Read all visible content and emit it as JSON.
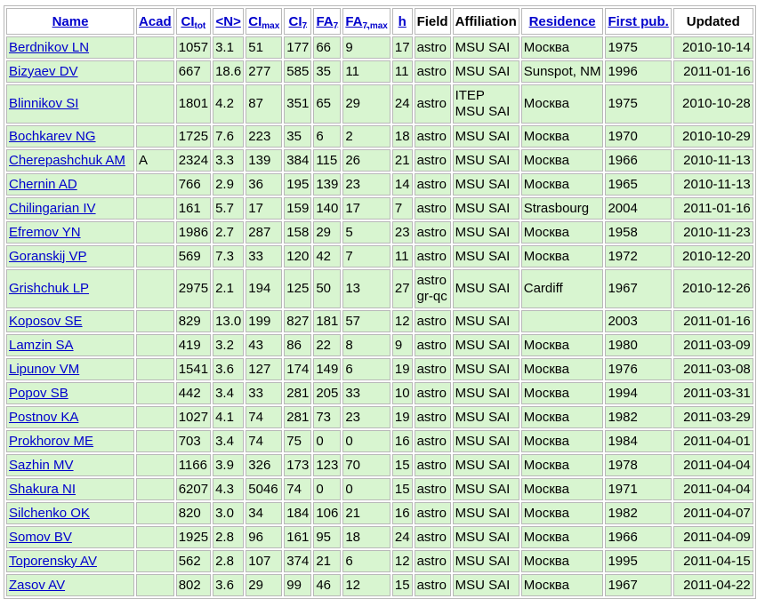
{
  "headers": {
    "name": "Name",
    "acad": "Acad",
    "ci_tot_main": "CI",
    "ci_tot_sub": "tot",
    "n": "<N>",
    "ci_max_main": "CI",
    "ci_max_sub": "max",
    "ci7_main": "CI",
    "ci7_sub": "7",
    "fa7_main": "FA",
    "fa7_sub": "7",
    "fa7max_main": "FA",
    "fa7max_sub": "7,max",
    "h": "h",
    "field": "Field",
    "affiliation": "Affiliation",
    "residence": "Residence",
    "first_pub": "First pub.",
    "updated": "Updated"
  },
  "rows": [
    {
      "name": "Berdnikov LN",
      "acad": "",
      "ci_tot": "1057",
      "n": "3.1",
      "ci_max": "51",
      "ci7": "177",
      "fa7": "66",
      "fa7max": "9",
      "h": "17",
      "field": [
        "astro"
      ],
      "affiliation": [
        "MSU SAI"
      ],
      "residence": "Москва",
      "first_pub": "1975",
      "updated": "2010-10-14"
    },
    {
      "name": "Bizyaev DV",
      "acad": "",
      "ci_tot": "667",
      "n": "18.6",
      "ci_max": "277",
      "ci7": "585",
      "fa7": "35",
      "fa7max": "11",
      "h": "11",
      "field": [
        "astro"
      ],
      "affiliation": [
        "MSU SAI"
      ],
      "residence": "Sunspot, NM",
      "first_pub": "1996",
      "updated": "2011-01-16"
    },
    {
      "name": "Blinnikov SI",
      "acad": "",
      "ci_tot": "1801",
      "n": "4.2",
      "ci_max": "87",
      "ci7": "351",
      "fa7": "65",
      "fa7max": "29",
      "h": "24",
      "field": [
        "astro"
      ],
      "affiliation": [
        "ITEP",
        "MSU SAI"
      ],
      "residence": "Москва",
      "first_pub": "1975",
      "updated": "2010-10-28"
    },
    {
      "name": "Bochkarev NG",
      "acad": "",
      "ci_tot": "1725",
      "n": "7.6",
      "ci_max": "223",
      "ci7": "35",
      "fa7": "6",
      "fa7max": "2",
      "h": "18",
      "field": [
        "astro"
      ],
      "affiliation": [
        "MSU SAI"
      ],
      "residence": "Москва",
      "first_pub": "1970",
      "updated": "2010-10-29"
    },
    {
      "name": "Cherepashchuk AM",
      "acad": "A",
      "ci_tot": "2324",
      "n": "3.3",
      "ci_max": "139",
      "ci7": "384",
      "fa7": "115",
      "fa7max": "26",
      "h": "21",
      "field": [
        "astro"
      ],
      "affiliation": [
        "MSU SAI"
      ],
      "residence": "Москва",
      "first_pub": "1966",
      "updated": "2010-11-13"
    },
    {
      "name": "Chernin AD",
      "acad": "",
      "ci_tot": "766",
      "n": "2.9",
      "ci_max": "36",
      "ci7": "195",
      "fa7": "139",
      "fa7max": "23",
      "h": "14",
      "field": [
        "astro"
      ],
      "affiliation": [
        "MSU SAI"
      ],
      "residence": "Москва",
      "first_pub": "1965",
      "updated": "2010-11-13"
    },
    {
      "name": "Chilingarian IV",
      "acad": "",
      "ci_tot": "161",
      "n": "5.7",
      "ci_max": "17",
      "ci7": "159",
      "fa7": "140",
      "fa7max": "17",
      "h": "7",
      "field": [
        "astro"
      ],
      "affiliation": [
        "MSU SAI"
      ],
      "residence": "Strasbourg",
      "first_pub": "2004",
      "updated": "2011-01-16"
    },
    {
      "name": "Efremov YN",
      "acad": "",
      "ci_tot": "1986",
      "n": "2.7",
      "ci_max": "287",
      "ci7": "158",
      "fa7": "29",
      "fa7max": "5",
      "h": "23",
      "field": [
        "astro"
      ],
      "affiliation": [
        "MSU SAI"
      ],
      "residence": "Москва",
      "first_pub": "1958",
      "updated": "2010-11-23"
    },
    {
      "name": "Goranskij VP",
      "acad": "",
      "ci_tot": "569",
      "n": "7.3",
      "ci_max": "33",
      "ci7": "120",
      "fa7": "42",
      "fa7max": "7",
      "h": "11",
      "field": [
        "astro"
      ],
      "affiliation": [
        "MSU SAI"
      ],
      "residence": "Москва",
      "first_pub": "1972",
      "updated": "2010-12-20"
    },
    {
      "name": "Grishchuk LP",
      "acad": "",
      "ci_tot": "2975",
      "n": "2.1",
      "ci_max": "194",
      "ci7": "125",
      "fa7": "50",
      "fa7max": "13",
      "h": "27",
      "field": [
        "astro",
        "gr-qc"
      ],
      "affiliation": [
        "MSU SAI"
      ],
      "residence": "Cardiff",
      "first_pub": "1967",
      "updated": "2010-12-26"
    },
    {
      "name": "Koposov SE",
      "acad": "",
      "ci_tot": "829",
      "n": "13.0",
      "ci_max": "199",
      "ci7": "827",
      "fa7": "181",
      "fa7max": "57",
      "h": "12",
      "field": [
        "astro"
      ],
      "affiliation": [
        "MSU SAI"
      ],
      "residence": "",
      "first_pub": "2003",
      "updated": "2011-01-16"
    },
    {
      "name": "Lamzin SA",
      "acad": "",
      "ci_tot": "419",
      "n": "3.2",
      "ci_max": "43",
      "ci7": "86",
      "fa7": "22",
      "fa7max": "8",
      "h": "9",
      "field": [
        "astro"
      ],
      "affiliation": [
        "MSU SAI"
      ],
      "residence": "Москва",
      "first_pub": "1980",
      "updated": "2011-03-09"
    },
    {
      "name": "Lipunov VM",
      "acad": "",
      "ci_tot": "1541",
      "n": "3.6",
      "ci_max": "127",
      "ci7": "174",
      "fa7": "149",
      "fa7max": "6",
      "h": "19",
      "field": [
        "astro"
      ],
      "affiliation": [
        "MSU SAI"
      ],
      "residence": "Москва",
      "first_pub": "1976",
      "updated": "2011-03-08"
    },
    {
      "name": "Popov SB",
      "acad": "",
      "ci_tot": "442",
      "n": "3.4",
      "ci_max": "33",
      "ci7": "281",
      "fa7": "205",
      "fa7max": "33",
      "h": "10",
      "field": [
        "astro"
      ],
      "affiliation": [
        "MSU SAI"
      ],
      "residence": "Москва",
      "first_pub": "1994",
      "updated": "2011-03-31"
    },
    {
      "name": "Postnov KA",
      "acad": "",
      "ci_tot": "1027",
      "n": "4.1",
      "ci_max": "74",
      "ci7": "281",
      "fa7": "73",
      "fa7max": "23",
      "h": "19",
      "field": [
        "astro"
      ],
      "affiliation": [
        "MSU SAI"
      ],
      "residence": "Москва",
      "first_pub": "1982",
      "updated": "2011-03-29"
    },
    {
      "name": "Prokhorov ME",
      "acad": "",
      "ci_tot": "703",
      "n": "3.4",
      "ci_max": "74",
      "ci7": "75",
      "fa7": "0",
      "fa7max": "0",
      "h": "16",
      "field": [
        "astro"
      ],
      "affiliation": [
        "MSU SAI"
      ],
      "residence": "Москва",
      "first_pub": "1984",
      "updated": "2011-04-01"
    },
    {
      "name": "Sazhin MV",
      "acad": "",
      "ci_tot": "1166",
      "n": "3.9",
      "ci_max": "326",
      "ci7": "173",
      "fa7": "123",
      "fa7max": "70",
      "h": "15",
      "field": [
        "astro"
      ],
      "affiliation": [
        "MSU SAI"
      ],
      "residence": "Москва",
      "first_pub": "1978",
      "updated": "2011-04-04"
    },
    {
      "name": "Shakura NI",
      "acad": "",
      "ci_tot": "6207",
      "n": "4.3",
      "ci_max": "5046",
      "ci7": "74",
      "fa7": "0",
      "fa7max": "0",
      "h": "15",
      "field": [
        "astro"
      ],
      "affiliation": [
        "MSU SAI"
      ],
      "residence": "Москва",
      "first_pub": "1971",
      "updated": "2011-04-04"
    },
    {
      "name": "Silchenko OK",
      "acad": "",
      "ci_tot": "820",
      "n": "3.0",
      "ci_max": "34",
      "ci7": "184",
      "fa7": "106",
      "fa7max": "21",
      "h": "16",
      "field": [
        "astro"
      ],
      "affiliation": [
        "MSU SAI"
      ],
      "residence": "Москва",
      "first_pub": "1982",
      "updated": "2011-04-07"
    },
    {
      "name": "Somov BV",
      "acad": "",
      "ci_tot": "1925",
      "n": "2.8",
      "ci_max": "96",
      "ci7": "161",
      "fa7": "95",
      "fa7max": "18",
      "h": "24",
      "field": [
        "astro"
      ],
      "affiliation": [
        "MSU SAI"
      ],
      "residence": "Москва",
      "first_pub": "1966",
      "updated": "2011-04-09"
    },
    {
      "name": "Toporensky AV",
      "acad": "",
      "ci_tot": "562",
      "n": "2.8",
      "ci_max": "107",
      "ci7": "374",
      "fa7": "21",
      "fa7max": "6",
      "h": "12",
      "field": [
        "astro"
      ],
      "affiliation": [
        "MSU SAI"
      ],
      "residence": "Москва",
      "first_pub": "1995",
      "updated": "2011-04-15"
    },
    {
      "name": "Zasov AV",
      "acad": "",
      "ci_tot": "802",
      "n": "3.6",
      "ci_max": "29",
      "ci7": "99",
      "fa7": "46",
      "fa7max": "12",
      "h": "15",
      "field": [
        "astro"
      ],
      "affiliation": [
        "MSU SAI"
      ],
      "residence": "Москва",
      "first_pub": "1967",
      "updated": "2011-04-22"
    }
  ]
}
